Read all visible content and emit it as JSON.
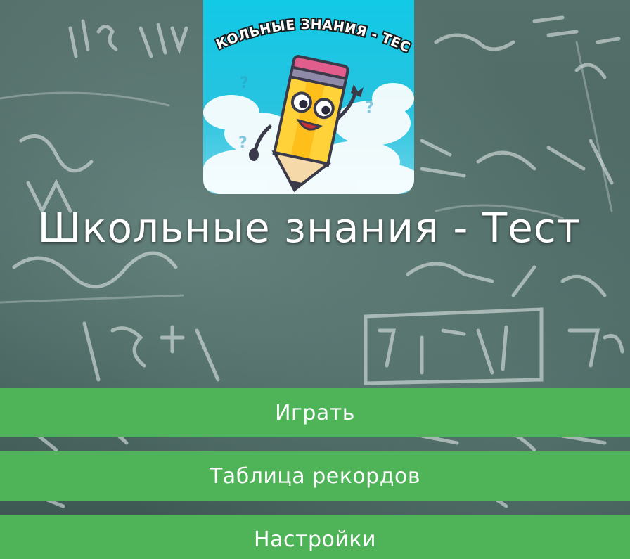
{
  "logo": {
    "arc_text": "ШКОЛЬНЫЕ ЗНАНИЯ - ТЕСТ"
  },
  "title": "Школьные знания - Тест",
  "menu": {
    "play_label": "Играть",
    "records_label": "Таблица рекордов",
    "settings_label": "Настройки"
  },
  "colors": {
    "button_green": "#4fb357",
    "logo_sky": "#12c9e6",
    "chalkboard": "#4a6661"
  }
}
